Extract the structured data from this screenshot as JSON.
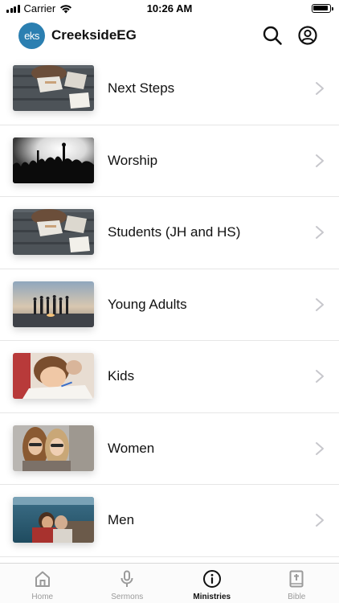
{
  "status_bar": {
    "carrier": "Carrier",
    "time": "10:26 AM"
  },
  "header": {
    "logo_text": "eks",
    "title": "CreeksideEG",
    "search_icon": "search-icon",
    "account_icon": "account-icon"
  },
  "ministries": [
    {
      "label": "Next Steps",
      "image": "reading-notebooks-photo"
    },
    {
      "label": "Worship",
      "image": "concert-crowd-photo"
    },
    {
      "label": "Students (JH and HS)",
      "image": "reading-notebooks-photo"
    },
    {
      "label": "Young Adults",
      "image": "beach-sunset-group-photo"
    },
    {
      "label": "Kids",
      "image": "child-drawing-photo"
    },
    {
      "label": "Women",
      "image": "two-women-selfie-photo"
    },
    {
      "label": "Men",
      "image": "men-by-sea-photo"
    }
  ],
  "tabbar": {
    "tabs": [
      {
        "label": "Home",
        "icon": "home-icon",
        "active": false
      },
      {
        "label": "Sermons",
        "icon": "microphone-icon",
        "active": false
      },
      {
        "label": "Ministries",
        "icon": "info-icon",
        "active": true
      },
      {
        "label": "Bible",
        "icon": "bible-icon",
        "active": false
      }
    ]
  },
  "colors": {
    "logo_bg": "#2b7fb1",
    "active_tab": "#111111",
    "inactive_tab": "#9a9a9a"
  }
}
